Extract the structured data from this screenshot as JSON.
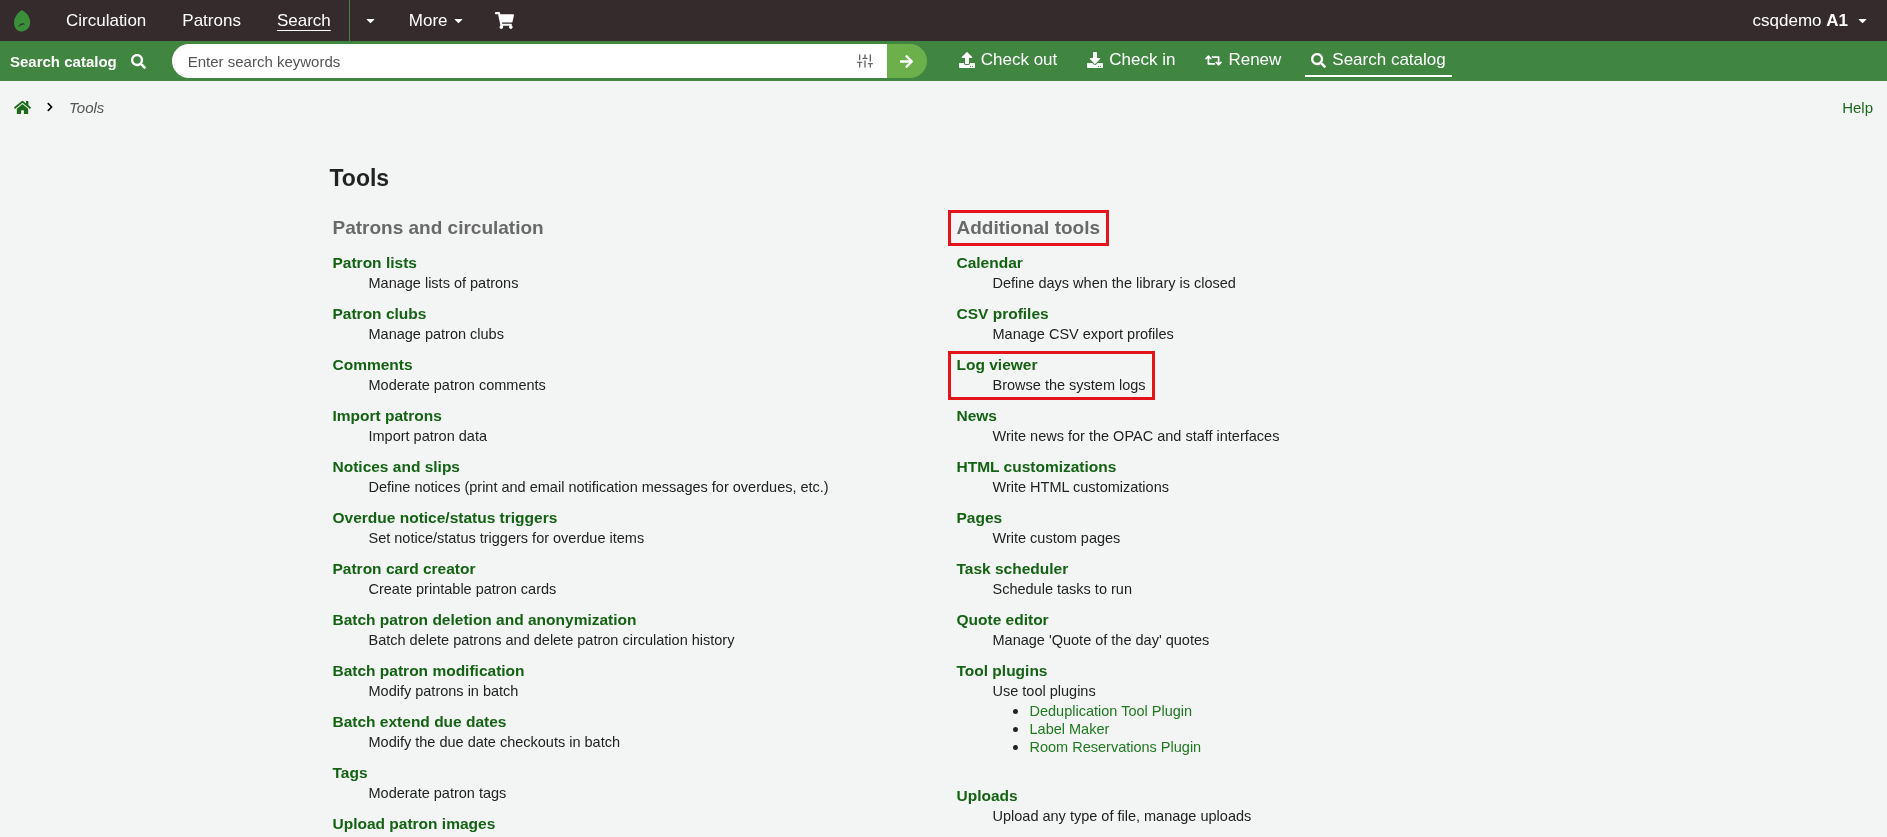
{
  "topbar": {
    "nav": [
      {
        "label": "Circulation",
        "selected": false,
        "kind": "link"
      },
      {
        "label": "Patrons",
        "selected": false,
        "kind": "link"
      },
      {
        "label": "Search",
        "selected": true,
        "kind": "split"
      },
      {
        "label": "More",
        "selected": false,
        "kind": "menu"
      }
    ],
    "user": {
      "name": "csqdemo",
      "branch": "A1"
    }
  },
  "searchbar": {
    "label": "Search catalog",
    "placeholder": "Enter search keywords"
  },
  "quick_links": [
    {
      "label": "Check out",
      "kind": "checkout",
      "selected": false
    },
    {
      "label": "Check in",
      "kind": "checkin",
      "selected": false
    },
    {
      "label": "Renew",
      "kind": "renew",
      "selected": false
    },
    {
      "label": "Search catalog",
      "kind": "search",
      "selected": true
    }
  ],
  "breadcrumb": {
    "items": [
      "Tools"
    ]
  },
  "help": "Help",
  "page_title": "Tools",
  "columns": [
    {
      "heading": "Patrons and circulation",
      "highlighted": false,
      "items": [
        {
          "title": "Patron lists",
          "description": "Manage lists of patrons",
          "highlighted": false
        },
        {
          "title": "Patron clubs",
          "description": "Manage patron clubs",
          "highlighted": false
        },
        {
          "title": "Comments",
          "description": "Moderate patron comments",
          "highlighted": false
        },
        {
          "title": "Import patrons",
          "description": "Import patron data",
          "highlighted": false
        },
        {
          "title": "Notices and slips",
          "description": "Define notices (print and email notification messages for overdues, etc.)",
          "highlighted": false
        },
        {
          "title": "Overdue notice/status triggers",
          "description": "Set notice/status triggers for overdue items",
          "highlighted": false
        },
        {
          "title": "Patron card creator",
          "description": "Create printable patron cards",
          "highlighted": false
        },
        {
          "title": "Batch patron deletion and anonymization",
          "description": "Batch delete patrons and delete patron circulation history",
          "highlighted": false
        },
        {
          "title": "Batch patron modification",
          "description": "Modify patrons in batch",
          "highlighted": false
        },
        {
          "title": "Batch extend due dates",
          "description": "Modify the due date checkouts in batch",
          "highlighted": false
        },
        {
          "title": "Tags",
          "description": "Moderate patron tags",
          "highlighted": false
        },
        {
          "title": "Upload patron images",
          "highlighted": false
        }
      ]
    },
    {
      "heading": "Additional tools",
      "highlighted": true,
      "items": [
        {
          "title": "Calendar",
          "description": "Define days when the library is closed",
          "highlighted": false
        },
        {
          "title": "CSV profiles",
          "description": "Manage CSV export profiles",
          "highlighted": false
        },
        {
          "title": "Log viewer",
          "description": "Browse the system logs",
          "highlighted": true
        },
        {
          "title": "News",
          "description": "Write news for the OPAC and staff interfaces",
          "highlighted": false
        },
        {
          "title": "HTML customizations",
          "description": "Write HTML customizations",
          "highlighted": false
        },
        {
          "title": "Pages",
          "description": "Write custom pages",
          "highlighted": false
        },
        {
          "title": "Task scheduler",
          "description": "Schedule tasks to run",
          "highlighted": false
        },
        {
          "title": "Quote editor",
          "description": "Manage 'Quote of the day' quotes",
          "highlighted": false
        },
        {
          "title": "Tool plugins",
          "description": "Use tool plugins",
          "highlighted": false,
          "plugins": [
            "Deduplication Tool Plugin",
            "Label Maker",
            "Room Reservations Plugin"
          ]
        },
        {
          "title": "Uploads",
          "description": "Upload any type of file, manage uploads",
          "highlighted": false
        }
      ]
    }
  ]
}
